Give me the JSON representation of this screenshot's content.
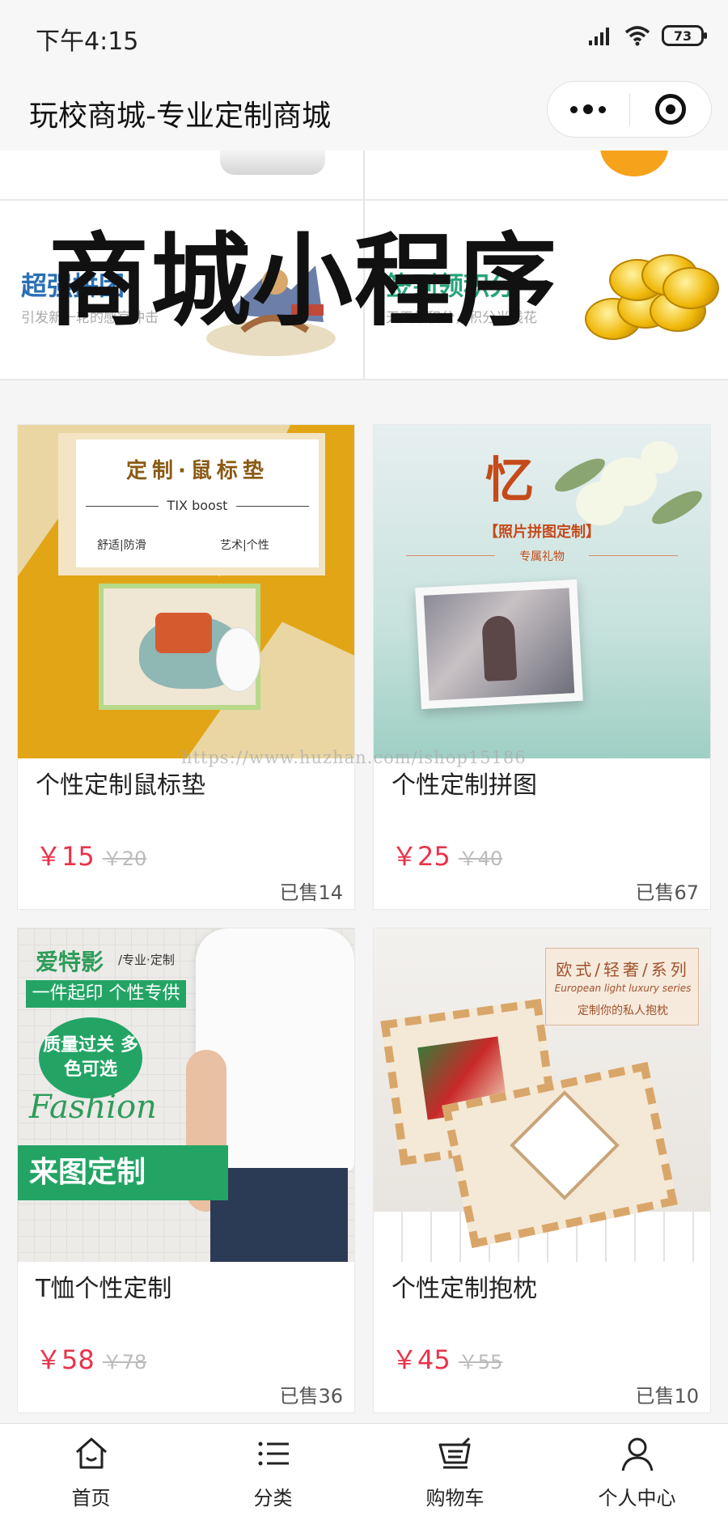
{
  "status_bar": {
    "time": "下午4:15",
    "battery": "73"
  },
  "nav": {
    "title": "玩校商城-专业定制商城"
  },
  "promo": {
    "left": {
      "title": "超强拼团",
      "desc": "引发新一轮的感官冲击"
    },
    "right": {
      "title": "签到领积分",
      "desc": "天天领积分，积分当钱花"
    },
    "overlay": "商城小程序"
  },
  "products": [
    {
      "name": "个性定制鼠标垫",
      "price": "￥15",
      "old_price": "￥20",
      "sold": "已售14",
      "img": {
        "title": "定制·鼠标垫",
        "sub": "TIX boost",
        "tags1": "舒适|防滑",
        "tags2": "艺术|个性"
      }
    },
    {
      "name": "个性定制拼图",
      "price": "￥25",
      "old_price": "￥40",
      "sold": "已售67",
      "img": {
        "title": "忆",
        "tag": "【照片拼图定制】",
        "sub": "专属礼物"
      }
    },
    {
      "name": "T恤个性定制",
      "price": "￥58",
      "old_price": "￥78",
      "sold": "已售36",
      "img": {
        "brand": "爱特影",
        "brand2": "/专业·定制",
        "bar": "一件起印 个性专供",
        "bubble": "质量过关 多色可选",
        "fashion": "Fashion",
        "ribbon": "来图定制"
      }
    },
    {
      "name": "个性定制抱枕",
      "price": "￥45",
      "old_price": "￥55",
      "sold": "已售10",
      "img": {
        "title": "欧式/轻奢/系列",
        "sub": "European light luxury series",
        "caption": "定制你的私人抱枕"
      }
    }
  ],
  "watermark": "https://www.huzhan.com/ishop15186",
  "tabs": [
    {
      "label": "首页",
      "icon": "home-icon"
    },
    {
      "label": "分类",
      "icon": "list-icon"
    },
    {
      "label": "购物车",
      "icon": "cart-icon"
    },
    {
      "label": "个人中心",
      "icon": "user-icon"
    }
  ],
  "colors": {
    "price": "#e8334a",
    "promo_left": "#2a6fb5",
    "promo_right": "#26a57a"
  }
}
